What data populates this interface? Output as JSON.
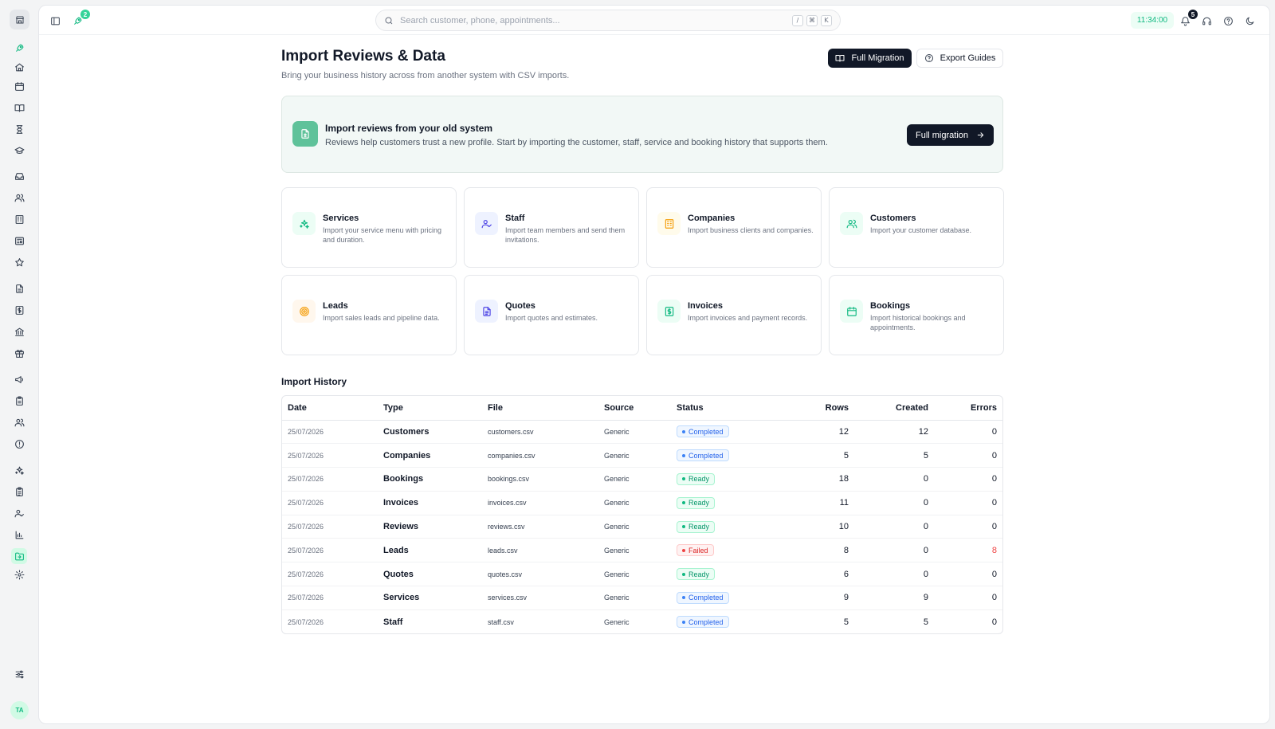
{
  "topbar": {
    "search_placeholder": "Search customer, phone, appointments...",
    "shortcut_keys": [
      "/",
      "⌘",
      "K"
    ],
    "rocket_badge": "2",
    "notification_badge": "5",
    "time": "11:34:00"
  },
  "sidebar": {
    "avatar_initials": "TA",
    "icons": [
      "rocket-icon",
      "home-icon",
      "calendar-icon",
      "book-icon",
      "hourglass-icon",
      "graduation-cap-icon",
      "inbox-icon",
      "users-icon",
      "building-icon",
      "newspaper-icon",
      "star-icon",
      "file-icon",
      "receipt-icon",
      "bank-icon",
      "gift-icon",
      "megaphone-icon",
      "clipboard-icon",
      "team-icon",
      "alert-circle-icon",
      "sparkles-icon",
      "clipboard-list-icon",
      "user-check-icon",
      "bar-chart-icon",
      "folder-import-icon",
      "settings-icon"
    ],
    "active_icon": "folder-import-icon"
  },
  "header": {
    "title": "Import Reviews & Data",
    "subtitle": "Bring your business history across from another system with CSV imports.",
    "full_migration_label": "Full Migration",
    "export_guides_label": "Export Guides"
  },
  "banner": {
    "title": "Import reviews from your old system",
    "text": "Reviews help customers trust a new profile. Start by importing the customer, staff, service and booking history that supports them.",
    "button_label": "Full migration"
  },
  "cards": [
    {
      "title": "Services",
      "desc": "Import your service menu with pricing and duration.",
      "icon": "sparkles-icon",
      "color": "#10b981",
      "bg": "#ecfdf5"
    },
    {
      "title": "Staff",
      "desc": "Import team members and send them invitations.",
      "icon": "user-check-icon",
      "color": "#4f46e5",
      "bg": "#eef2ff"
    },
    {
      "title": "Companies",
      "desc": "Import business clients and companies.",
      "icon": "building-icon",
      "color": "#f59e0b",
      "bg": "#fffbeb"
    },
    {
      "title": "Customers",
      "desc": "Import your customer database.",
      "icon": "users-icon",
      "color": "#10b981",
      "bg": "#ecfdf5"
    },
    {
      "title": "Leads",
      "desc": "Import sales leads and pipeline data.",
      "icon": "target-icon",
      "color": "#f59e0b",
      "bg": "#fff7ed"
    },
    {
      "title": "Quotes",
      "desc": "Import quotes and estimates.",
      "icon": "document-icon",
      "color": "#4f46e5",
      "bg": "#eef2ff"
    },
    {
      "title": "Invoices",
      "desc": "Import invoices and payment records.",
      "icon": "invoice-icon",
      "color": "#10b981",
      "bg": "#ecfdf5"
    },
    {
      "title": "Bookings",
      "desc": "Import historical bookings and appointments.",
      "icon": "calendar-icon",
      "color": "#10b981",
      "bg": "#ecfdf5"
    }
  ],
  "history": {
    "title": "Import History",
    "columns": [
      "Date",
      "Type",
      "File",
      "Source",
      "Status",
      "Rows",
      "Created",
      "Errors"
    ],
    "rows": [
      {
        "date": "25/07/2026",
        "type": "Customers",
        "file": "customers.csv",
        "source": "Generic",
        "status": "Completed",
        "rows": "12",
        "created": "12",
        "errors": "0"
      },
      {
        "date": "25/07/2026",
        "type": "Companies",
        "file": "companies.csv",
        "source": "Generic",
        "status": "Completed",
        "rows": "5",
        "created": "5",
        "errors": "0"
      },
      {
        "date": "25/07/2026",
        "type": "Bookings",
        "file": "bookings.csv",
        "source": "Generic",
        "status": "Ready",
        "rows": "18",
        "created": "0",
        "errors": "0"
      },
      {
        "date": "25/07/2026",
        "type": "Invoices",
        "file": "invoices.csv",
        "source": "Generic",
        "status": "Ready",
        "rows": "11",
        "created": "0",
        "errors": "0"
      },
      {
        "date": "25/07/2026",
        "type": "Reviews",
        "file": "reviews.csv",
        "source": "Generic",
        "status": "Ready",
        "rows": "10",
        "created": "0",
        "errors": "0"
      },
      {
        "date": "25/07/2026",
        "type": "Leads",
        "file": "leads.csv",
        "source": "Generic",
        "status": "Failed",
        "rows": "8",
        "created": "0",
        "errors": "8"
      },
      {
        "date": "25/07/2026",
        "type": "Quotes",
        "file": "quotes.csv",
        "source": "Generic",
        "status": "Ready",
        "rows": "6",
        "created": "0",
        "errors": "0"
      },
      {
        "date": "25/07/2026",
        "type": "Services",
        "file": "services.csv",
        "source": "Generic",
        "status": "Completed",
        "rows": "9",
        "created": "9",
        "errors": "0"
      },
      {
        "date": "25/07/2026",
        "type": "Staff",
        "file": "staff.csv",
        "source": "Generic",
        "status": "Completed",
        "rows": "5",
        "created": "5",
        "errors": "0"
      }
    ]
  }
}
